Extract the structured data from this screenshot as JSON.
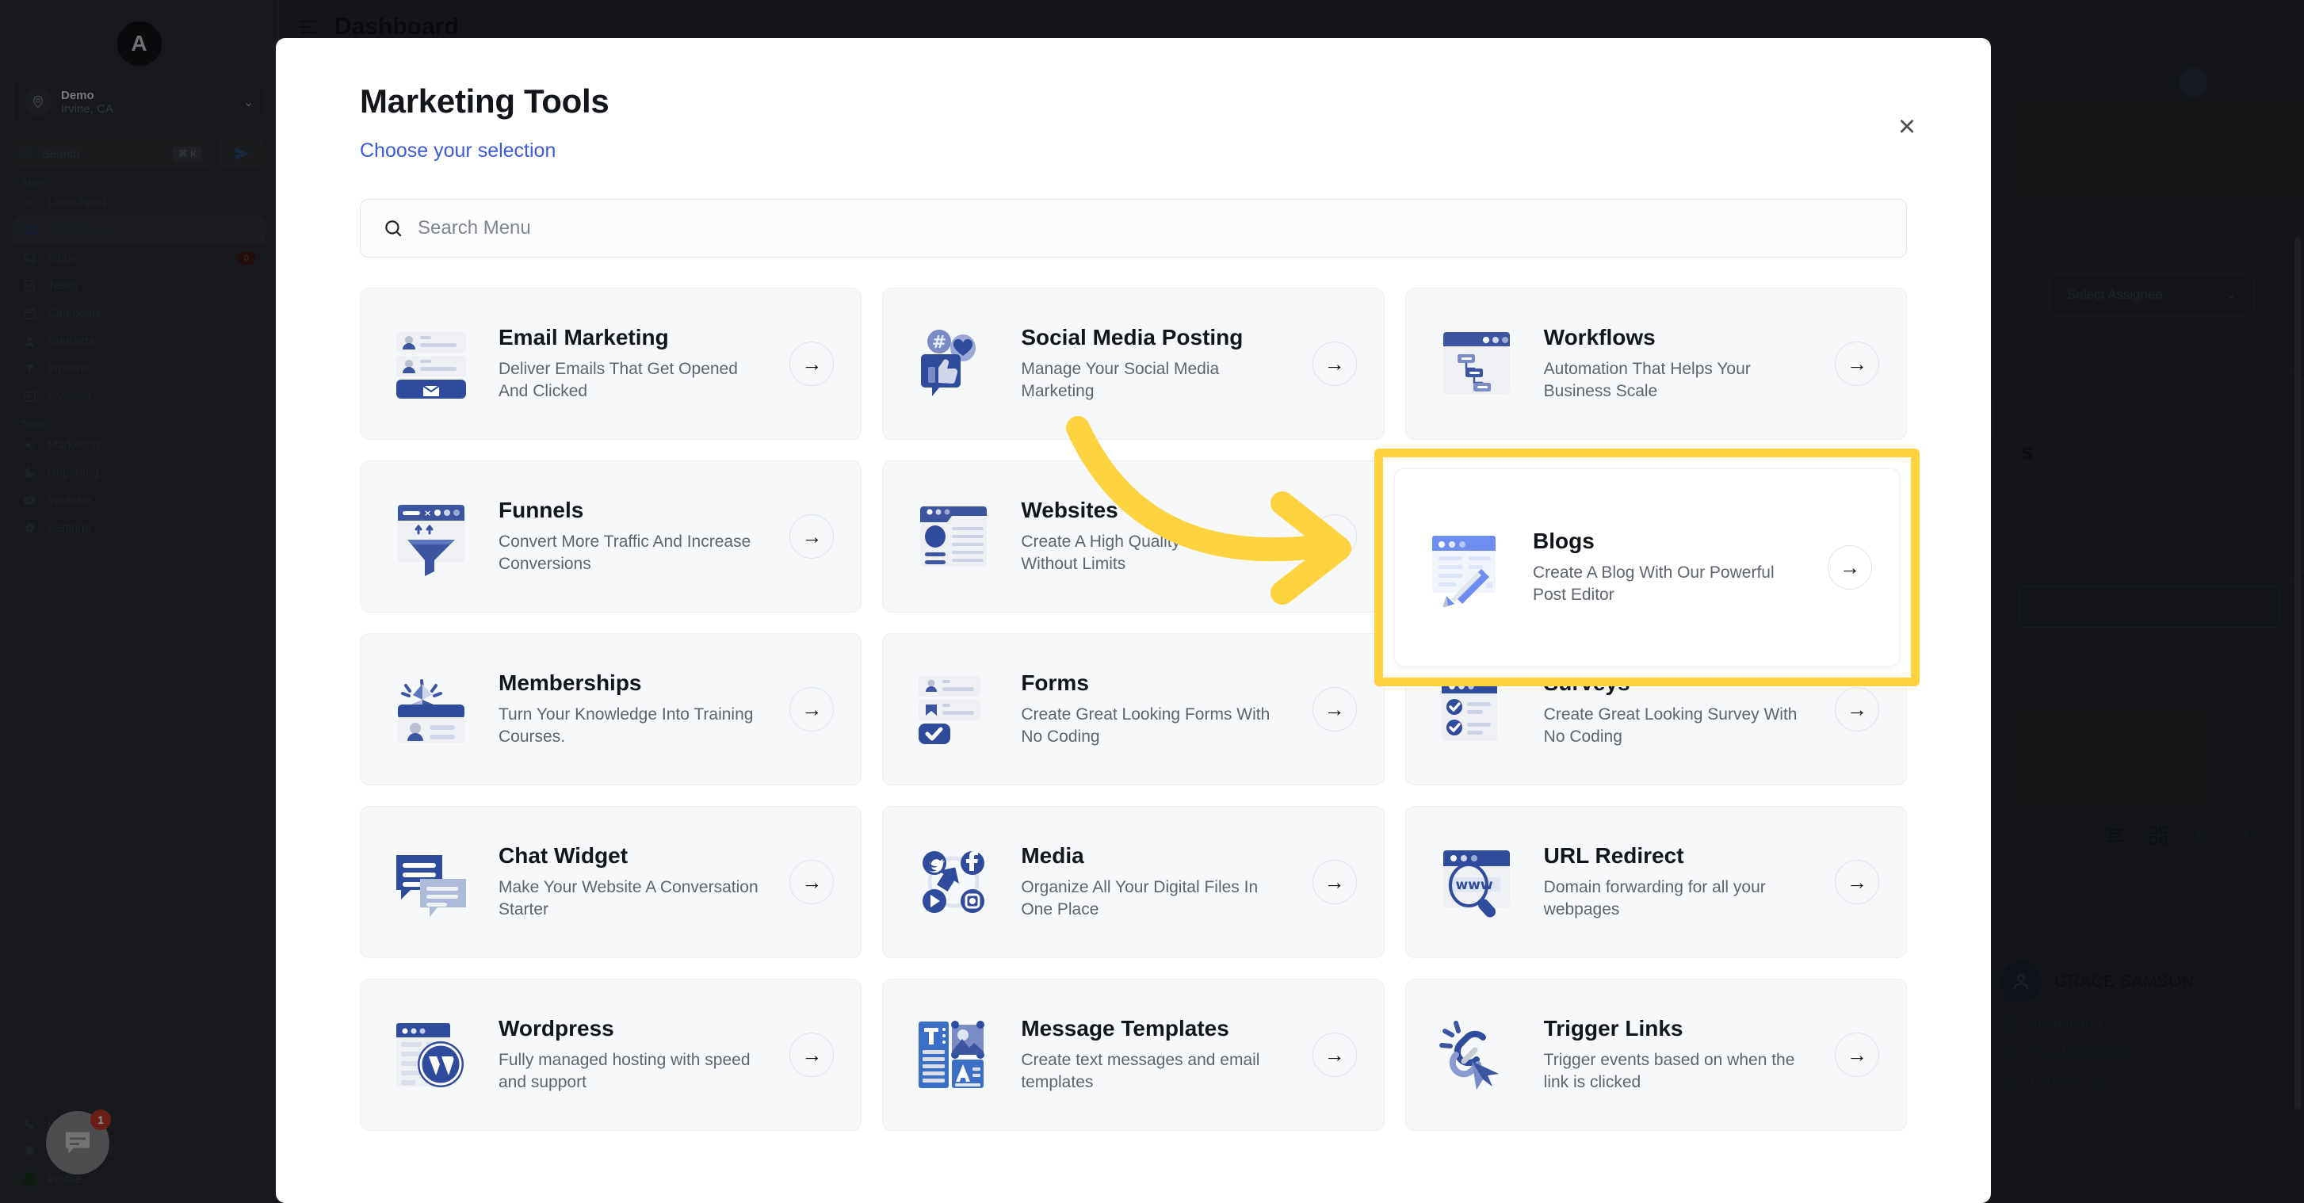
{
  "background": {
    "page_title": "Dashboard",
    "sidebar": {
      "logo_letter": "A",
      "location": {
        "name": "Demo",
        "sub": "Irvine, CA",
        "chevron": "chevron-down-icon"
      },
      "search": {
        "placeholder": "Search",
        "shortcut": "⌘ K"
      },
      "groups": [
        {
          "label": "Apps",
          "items": [
            {
              "label": "Launchpad",
              "icon": "launchpad-icon",
              "badge": null,
              "active": false
            },
            {
              "label": "Dashboard",
              "icon": "dashboard-icon",
              "badge": null,
              "active": true
            },
            {
              "label": "Inbox",
              "icon": "inbox-icon",
              "badge": "0",
              "active": false
            },
            {
              "label": "Tasks",
              "icon": "tasks-icon",
              "badge": null,
              "active": false
            },
            {
              "label": "Calendars",
              "icon": "calendar-icon",
              "badge": null,
              "active": false
            },
            {
              "label": "Contacts",
              "icon": "contacts-icon",
              "badge": null,
              "active": false
            },
            {
              "label": "Pipeline",
              "icon": "pipeline-icon",
              "badge": null,
              "active": false
            },
            {
              "label": "Invoices",
              "icon": "invoices-icon",
              "badge": null,
              "active": false
            }
          ]
        },
        {
          "label": "Tools",
          "items": [
            {
              "label": "Marketing",
              "icon": "megaphone-icon",
              "badge": null,
              "active": false
            },
            {
              "label": "Reporting",
              "icon": "reporting-icon",
              "badge": null,
              "active": false
            },
            {
              "label": "Youtube",
              "icon": "youtube-icon",
              "badge": null,
              "active": false
            },
            {
              "label": "Settings",
              "icon": "gear-icon",
              "badge": null,
              "active": false
            }
          ]
        }
      ],
      "bottom_items": [
        {
          "label": "Phone",
          "icon": "phone-icon"
        },
        {
          "label": "Notifications",
          "icon": "bell-icon"
        },
        {
          "label": "Profile",
          "icon": "avatar-icon"
        }
      ]
    },
    "assignee_select": {
      "label": "Select Assignee",
      "chevron": "chevron-down-icon"
    },
    "word_fragment": "s",
    "contact_card": {
      "name": "GRACE SAMSON",
      "company": "None found",
      "phone": "+639108965345",
      "last_activity": "18 hours ago"
    },
    "chat_bubble_badge": "1"
  },
  "modal": {
    "title": "Marketing Tools",
    "subtitle": "Choose your selection",
    "close_label": "×",
    "search": {
      "placeholder": "Search Menu",
      "icon": "search-icon"
    },
    "cards": [
      {
        "title": "Email Marketing",
        "desc": "Deliver Emails That Get Opened And Clicked",
        "icon": "email-marketing-icon",
        "arrow": "arrow-right-icon",
        "highlighted": false
      },
      {
        "title": "Social Media Posting",
        "desc": "Manage Your Social Media Marketing",
        "icon": "social-media-icon",
        "arrow": "arrow-right-icon",
        "highlighted": false
      },
      {
        "title": "Workflows",
        "desc": "Automation That Helps Your Business Scale",
        "icon": "workflows-icon",
        "arrow": "arrow-right-icon",
        "highlighted": false
      },
      {
        "title": "Funnels",
        "desc": "Convert More Traffic And Increase Conversions",
        "icon": "funnels-icon",
        "arrow": "arrow-right-icon",
        "highlighted": false
      },
      {
        "title": "Websites",
        "desc": "Create A High Quality Website Without Limits",
        "icon": "websites-icon",
        "arrow": "arrow-right-icon",
        "highlighted": false
      },
      {
        "title": "Blogs",
        "desc": "Create A Blog With Our Powerful Post Editor",
        "icon": "blogs-icon",
        "arrow": "arrow-right-icon",
        "highlighted": true
      },
      {
        "title": "Memberships",
        "desc": "Turn Your Knowledge Into Training Courses.",
        "icon": "memberships-icon",
        "arrow": "arrow-right-icon",
        "highlighted": false
      },
      {
        "title": "Forms",
        "desc": "Create Great Looking Forms With No Coding",
        "icon": "forms-icon",
        "arrow": "arrow-right-icon",
        "highlighted": false
      },
      {
        "title": "Surveys",
        "desc": "Create Great Looking Survey With No Coding",
        "icon": "surveys-icon",
        "arrow": "arrow-right-icon",
        "highlighted": false
      },
      {
        "title": "Chat Widget",
        "desc": "Make Your Website A Conversation Starter",
        "icon": "chat-widget-icon",
        "arrow": "arrow-right-icon",
        "highlighted": false
      },
      {
        "title": "Media",
        "desc": "Organize All Your Digital Files In One Place",
        "icon": "media-icon",
        "arrow": "arrow-right-icon",
        "highlighted": false
      },
      {
        "title": "URL Redirect",
        "desc": "Domain forwarding for all your webpages",
        "icon": "url-redirect-icon",
        "arrow": "arrow-right-icon",
        "highlighted": false
      },
      {
        "title": "Wordpress",
        "desc": "Fully managed hosting with speed and support",
        "icon": "wordpress-icon",
        "arrow": "arrow-right-icon",
        "highlighted": false
      },
      {
        "title": "Message Templates",
        "desc": "Create text messages and email templates",
        "icon": "message-templates-icon",
        "arrow": "arrow-right-icon",
        "highlighted": false
      },
      {
        "title": "Trigger Links",
        "desc": "Trigger events based on when the link is clicked",
        "icon": "trigger-links-icon",
        "arrow": "arrow-right-icon",
        "highlighted": false
      }
    ]
  },
  "annotation": {
    "arrow_color": "#ffd23f",
    "highlight_color": "#ffd23f",
    "target_card": "Blogs"
  }
}
